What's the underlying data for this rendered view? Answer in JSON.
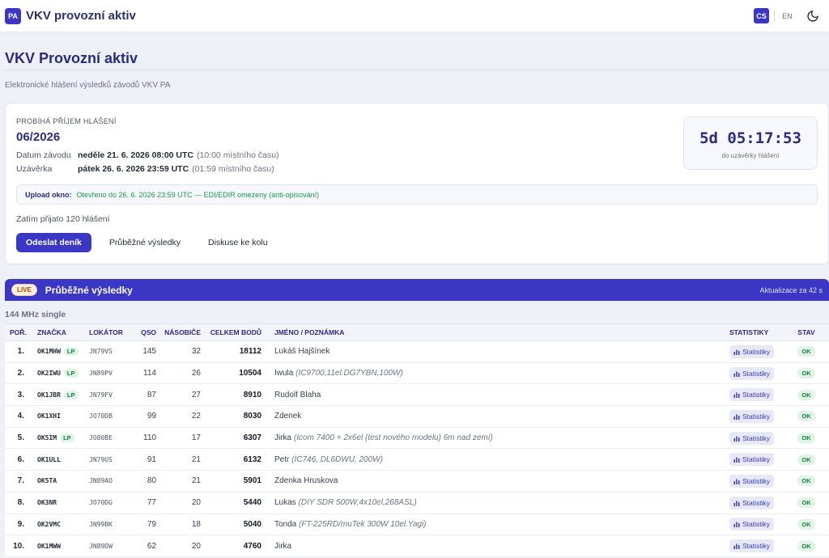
{
  "app": {
    "logo_text": "PA",
    "title": "VKV provozní aktiv"
  },
  "lang": {
    "active": "CS",
    "other": "EN"
  },
  "header": {
    "title": "VKV Provozní aktiv",
    "subtitle": "Elektronické hlášení výsledků závodů VKV PA"
  },
  "contest": {
    "status": "PROBÍHÁ PŘÍJEM HLÁŠENÍ",
    "round": "06/2026",
    "date_label": "Datum závodu",
    "date_value": "neděle 21. 6. 2026 08:00 UTC",
    "date_local": "(10:00 místního času)",
    "close_label": "Uzávěrka",
    "close_value": "pátek 26. 6. 2026 23:59 UTC",
    "close_local": "(01:59 místního času)",
    "countdown": "5d 05:17:53",
    "countdown_label": "do uzávěrky hlášení",
    "upload_label": "Upload okno:",
    "upload_value": "Otevřeno do 26. 6. 2026 23:59 UTC — EDI/EDIR omezeny (anti-opisování)",
    "received": "Zatím přijato 120 hlášení",
    "btn_submit": "Odeslat deník",
    "btn_results": "Průběžné výsledky",
    "btn_discussion": "Diskuse ke kolu"
  },
  "live": {
    "pill": "LIVE",
    "title": "Průběžné výsledky",
    "update": "Aktualizace za 42 s"
  },
  "category": "144 MHz single",
  "table": {
    "headers": {
      "pos": "POŘ.",
      "call": "ZNAČKA",
      "loc": "LOKÁTOR",
      "qso": "QSO",
      "mult": "NÁSOBIČE",
      "pts": "CELKEM BODŮ",
      "name": "JMÉNO / POZNÁMKA",
      "stat": "STATISTIKY",
      "state": "STAV"
    },
    "stat_label": "Statistiky",
    "ok_label": "OK",
    "lp_label": "LP",
    "rows": [
      {
        "pos": "1.",
        "call": "OK1MHW",
        "lp": true,
        "loc": "JN79VS",
        "qso": "145",
        "mult": "32",
        "pts": "18112",
        "name": "Lukáš Hajšínek",
        "note": ""
      },
      {
        "pos": "2.",
        "call": "OK2IWU",
        "lp": true,
        "loc": "JN89PV",
        "qso": "114",
        "mult": "26",
        "pts": "10504",
        "name": "Iwula",
        "note": "(IC9700,11el.DG7YBN,100W)"
      },
      {
        "pos": "3.",
        "call": "OK1JBR",
        "lp": true,
        "loc": "JN79FV",
        "qso": "87",
        "mult": "27",
        "pts": "8910",
        "name": "Rudolf Blaha",
        "note": ""
      },
      {
        "pos": "4.",
        "call": "OK1XHI",
        "lp": false,
        "loc": "JO70DB",
        "qso": "99",
        "mult": "22",
        "pts": "8030",
        "name": "Zdenek",
        "note": ""
      },
      {
        "pos": "5.",
        "call": "OK5IM",
        "lp": true,
        "loc": "JO80BE",
        "qso": "110",
        "mult": "17",
        "pts": "6307",
        "name": "Jirka",
        "note": "(Icom 7400 + 2x6el (test nového modelu) 6m nad zemí)"
      },
      {
        "pos": "6.",
        "call": "OK1ULL",
        "lp": false,
        "loc": "JN79US",
        "qso": "91",
        "mult": "21",
        "pts": "6132",
        "name": "Petr",
        "note": "(IC746, DL6DWU, 200W)"
      },
      {
        "pos": "7.",
        "call": "OK5TA",
        "lp": false,
        "loc": "JN89AO",
        "qso": "80",
        "mult": "21",
        "pts": "5901",
        "name": "Zdenka Hruskova",
        "note": ""
      },
      {
        "pos": "8.",
        "call": "OK3NR",
        "lp": false,
        "loc": "JO70DG",
        "qso": "77",
        "mult": "20",
        "pts": "5440",
        "name": "Lukas",
        "note": "(DIY SDR 500W,4x10el,268ASL)"
      },
      {
        "pos": "9.",
        "call": "OK2VMC",
        "lp": false,
        "loc": "JN99BK",
        "qso": "79",
        "mult": "18",
        "pts": "5040",
        "name": "Tonda",
        "note": "(FT-225RD/muTek 300W 10el.Yagi)"
      },
      {
        "pos": "10.",
        "call": "OK1MWW",
        "lp": false,
        "loc": "JN89DW",
        "qso": "62",
        "mult": "20",
        "pts": "4760",
        "name": "Jirka",
        "note": ""
      }
    ]
  }
}
